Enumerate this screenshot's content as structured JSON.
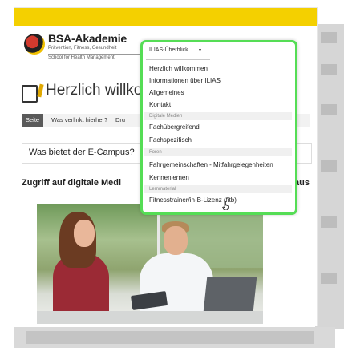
{
  "logo": {
    "name": "BSA-Akademie",
    "line1": "Prävention, Fitness, Gesundheit",
    "line2": "School for Health Management"
  },
  "page": {
    "title": "Herzlich willkom",
    "tabs": [
      "Seite",
      "Was verlinkt hierher?",
      "Dru"
    ],
    "question": "Was bietet der E-Campus?",
    "access_heading": "Zugriff auf digitale Medi",
    "access_heading_end": "aus"
  },
  "dropdown": {
    "trigger_label": "ILIAS-Überblick",
    "trigger_caret": "▾",
    "items": [
      {
        "label": "Herzlich willkommen"
      },
      {
        "label": "Informationen über ILIAS"
      },
      {
        "label": "Allgemeines"
      },
      {
        "label": "Kontakt"
      }
    ],
    "section_digital": "Digitale Medien",
    "digital_items": [
      {
        "label": "Fachübergreifend"
      },
      {
        "label": "Fachspezifisch"
      }
    ],
    "section_foren": "Foren",
    "foren_items": [
      {
        "label": "Fahrgemeinschaften - Mitfahrgelegenheiten"
      },
      {
        "label": "Kennenlernen"
      }
    ],
    "section_lern": "Lernmaterial",
    "lern_items": [
      {
        "label": "Fitnesstrainer/in-B-Lizenz (fitb)"
      }
    ]
  },
  "colors": {
    "topbar": "#f4d000",
    "highlight_frame": "#55dd55",
    "active_tab": "#5a5a5a"
  },
  "icons": {
    "cursor": "hand-pointer-icon",
    "page_icon": "document-pencil-icon"
  }
}
